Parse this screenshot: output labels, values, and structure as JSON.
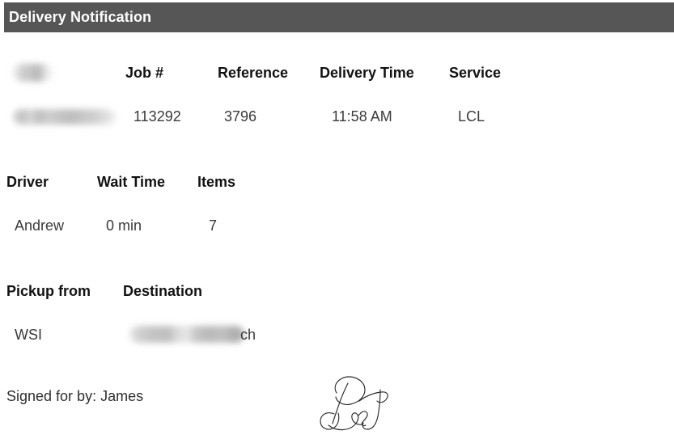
{
  "header": {
    "title": "Delivery Notification",
    "bar_color": "#565656",
    "text_color": "#ffffff"
  },
  "job_section": {
    "columns": [
      {
        "label": "",
        "value": "",
        "redacted": true,
        "kind": "company-logo"
      },
      {
        "label": "Job #",
        "value": "113292"
      },
      {
        "label": "Reference",
        "value": "3796"
      },
      {
        "label": "Delivery Time",
        "value": "11:58 AM"
      },
      {
        "label": "Service",
        "value": "LCL"
      }
    ]
  },
  "driver_section": {
    "columns": [
      {
        "label": "Driver",
        "value": "Andrew"
      },
      {
        "label": "Wait Time",
        "value": "0 min"
      },
      {
        "label": "Items",
        "value": "7"
      }
    ]
  },
  "route_section": {
    "columns": [
      {
        "label": "Pickup from",
        "value": "WSI"
      },
      {
        "label": "Destination",
        "value": "ch",
        "redacted": true
      }
    ]
  },
  "signature_block": {
    "signed_for_by": "Signed for by: James",
    "signature_image": "handwritten-signature",
    "ink_color": "#2b2b2b"
  }
}
